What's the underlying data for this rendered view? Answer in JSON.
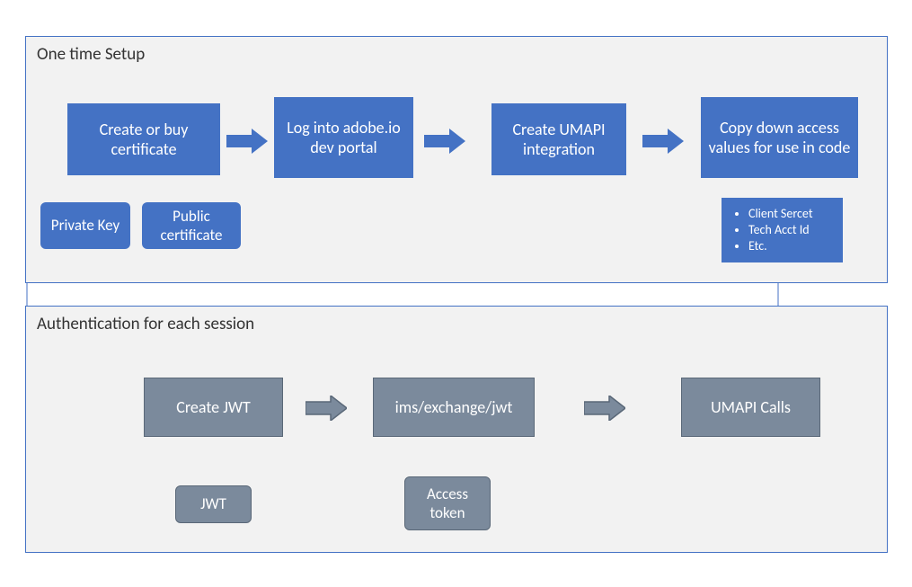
{
  "sections": {
    "setup": {
      "title": "One time Setup"
    },
    "auth": {
      "title": "Authentication for each session"
    }
  },
  "setup_boxes": {
    "cert": "Create or buy certificate",
    "login": "Log into adobe.io dev portal",
    "create": "Create UMAPI integration",
    "copy": "Copy down access values for  use in code",
    "privkey": "Private Key",
    "pubcert": "Public certificate"
  },
  "setup_list": {
    "items": [
      "Client Sercet",
      "Tech Acct Id",
      "Etc."
    ]
  },
  "auth_boxes": {
    "createjwt": "Create JWT",
    "exchange": "ims/exchange/jwt",
    "calls": "UMAPI Calls",
    "jwt": "JWT",
    "token": "Access token"
  }
}
